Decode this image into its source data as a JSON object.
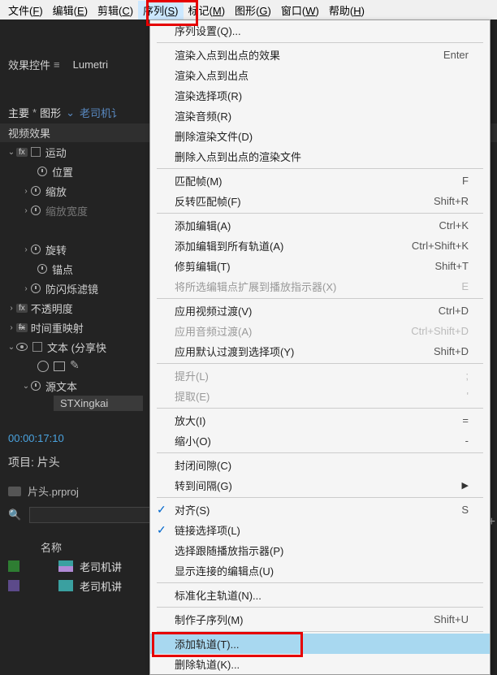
{
  "menubar": {
    "items": [
      {
        "label": "文件",
        "accel": "F"
      },
      {
        "label": "编辑",
        "accel": "E"
      },
      {
        "label": "剪辑",
        "accel": "C"
      },
      {
        "label": "序列",
        "accel": "S"
      },
      {
        "label": "标记",
        "accel": "M"
      },
      {
        "label": "图形",
        "accel": "G"
      },
      {
        "label": "窗口",
        "accel": "W"
      },
      {
        "label": "帮助",
        "accel": "H"
      }
    ]
  },
  "panel": {
    "tab_effects": "效果控件",
    "tab_lumetri": "Lumetri",
    "clip_primary": "主要",
    "clip_star": "*",
    "clip_type": "图形",
    "clip_name": "老司机讠",
    "section_video_effects": "视频效果",
    "tree": {
      "motion": "运动",
      "position": "位置",
      "scale": "缩放",
      "scale_width": "缩放宽度",
      "rotation": "旋转",
      "anchor": "锚点",
      "antiflicker": "防闪烁滤镜",
      "opacity": "不透明度",
      "time_remap": "时间重映射",
      "text_layer": "文本 (分享快",
      "source_text": "源文本"
    },
    "font_value": "STXingkai",
    "timecode": "00:00:17:10"
  },
  "project": {
    "header": "项目: 片头",
    "proj_file": "片头.prproj",
    "column_name": "名称",
    "items": [
      {
        "label": "老司机讲"
      },
      {
        "label": "老司机讲"
      }
    ]
  },
  "dropdown": {
    "items": [
      {
        "label": "序列设置(Q)..."
      },
      {
        "sep": true
      },
      {
        "label": "渲染入点到出点的效果",
        "shortcut": "Enter"
      },
      {
        "label": "渲染入点到出点"
      },
      {
        "label": "渲染选择项(R)"
      },
      {
        "label": "渲染音频(R)"
      },
      {
        "label": "删除渲染文件(D)"
      },
      {
        "label": "删除入点到出点的渲染文件"
      },
      {
        "sep": true
      },
      {
        "label": "匹配帧(M)",
        "shortcut": "F"
      },
      {
        "label": "反转匹配帧(F)",
        "shortcut": "Shift+R"
      },
      {
        "sep": true
      },
      {
        "label": "添加编辑(A)",
        "shortcut": "Ctrl+K"
      },
      {
        "label": "添加编辑到所有轨道(A)",
        "shortcut": "Ctrl+Shift+K"
      },
      {
        "label": "修剪编辑(T)",
        "shortcut": "Shift+T"
      },
      {
        "label": "将所选编辑点扩展到播放指示器(X)",
        "shortcut": "E",
        "disabled": true
      },
      {
        "sep": true
      },
      {
        "label": "应用视频过渡(V)",
        "shortcut": "Ctrl+D"
      },
      {
        "label": "应用音频过渡(A)",
        "shortcut": "Ctrl+Shift+D",
        "disabled": true
      },
      {
        "label": "应用默认过渡到选择项(Y)",
        "shortcut": "Shift+D"
      },
      {
        "sep": true
      },
      {
        "label": "提升(L)",
        "shortcut": ";",
        "disabled": true
      },
      {
        "label": "提取(E)",
        "shortcut": "'",
        "disabled": true
      },
      {
        "sep": true
      },
      {
        "label": "放大(I)",
        "shortcut": "="
      },
      {
        "label": "缩小(O)",
        "shortcut": "-"
      },
      {
        "sep": true
      },
      {
        "label": "封闭间隙(C)"
      },
      {
        "label": "转到间隔(G)",
        "submenu": true
      },
      {
        "sep": true
      },
      {
        "label": "对齐(S)",
        "shortcut": "S",
        "checked": true
      },
      {
        "label": "链接选择项(L)",
        "checked": true
      },
      {
        "label": "选择跟随播放指示器(P)"
      },
      {
        "label": "显示连接的编辑点(U)"
      },
      {
        "sep": true
      },
      {
        "label": "标准化主轨道(N)..."
      },
      {
        "sep": true
      },
      {
        "label": "制作子序列(M)",
        "shortcut": "Shift+U"
      },
      {
        "sep": true
      },
      {
        "label": "添加轨道(T)...",
        "highlighted": true
      },
      {
        "label": "删除轨道(K)..."
      }
    ]
  }
}
